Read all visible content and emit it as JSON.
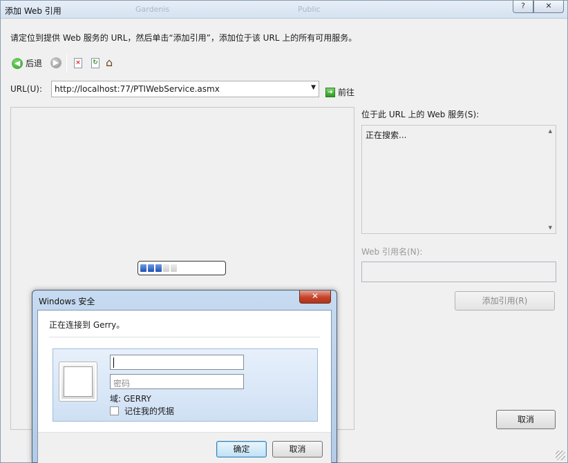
{
  "window": {
    "title": "添加 Web 引用",
    "help_glyph": "?",
    "close_glyph": "✕",
    "blurred_bg_1": "Gardenis",
    "blurred_bg_2": "Public"
  },
  "instruction": "请定位到提供 Web 服务的 URL，然后单击“添加引用”，添加位于该 URL 上的所有可用服务。",
  "toolbar": {
    "back_label": "后退",
    "back_glyph": "◀",
    "forward_glyph": "▶",
    "stop_glyph": "×",
    "refresh_glyph": "↻",
    "home_glyph": "⌂"
  },
  "url": {
    "label": "URL(U):",
    "value": "http://localhost:77/PTIWebService.asmx",
    "arrow_glyph": "▼",
    "go_label": "前往",
    "go_glyph": "➜"
  },
  "progress": {
    "total_segments": 5,
    "filled_segments": 3,
    "colors": {
      "on": "#1e4fb4",
      "off": "#cfcfcf"
    }
  },
  "services": {
    "label": "位于此 URL 上的 Web 服务(S):",
    "status": "正在搜索...",
    "scroll_up_glyph": "▲",
    "scroll_down_glyph": "▼"
  },
  "reference": {
    "name_label": "Web 引用名(N):",
    "name_value": "",
    "add_button": "添加引用(R)"
  },
  "main_cancel_button": "取消",
  "security_dialog": {
    "title": "Windows 安全",
    "close_glyph": "✕",
    "connecting_text": "正在连接到 Gerry。",
    "username_value": "",
    "password_placeholder": "密码",
    "domain_text": "域: GERRY",
    "remember_label": "记住我的凭据",
    "remember_checked": false,
    "ok_button": "确定",
    "cancel_button": "取消"
  }
}
